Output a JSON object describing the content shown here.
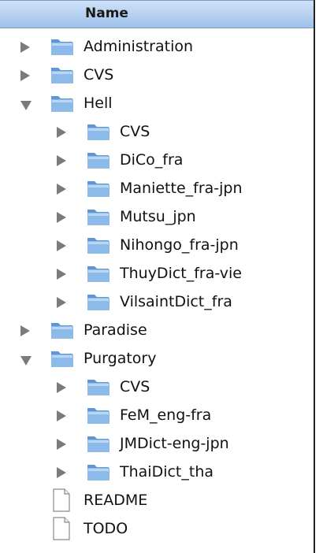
{
  "header": {
    "column_name": "Name"
  },
  "rows": [
    {
      "label": "Administration",
      "level": 0,
      "type": "folder",
      "state": "collapsed"
    },
    {
      "label": "CVS",
      "level": 0,
      "type": "folder",
      "state": "collapsed"
    },
    {
      "label": "Hell",
      "level": 0,
      "type": "folder",
      "state": "expanded"
    },
    {
      "label": "CVS",
      "level": 1,
      "type": "folder",
      "state": "collapsed"
    },
    {
      "label": "DiCo_fra",
      "level": 1,
      "type": "folder",
      "state": "collapsed"
    },
    {
      "label": "Maniette_fra-jpn",
      "level": 1,
      "type": "folder",
      "state": "collapsed"
    },
    {
      "label": "Mutsu_jpn",
      "level": 1,
      "type": "folder",
      "state": "collapsed"
    },
    {
      "label": "Nihongo_fra-jpn",
      "level": 1,
      "type": "folder",
      "state": "collapsed"
    },
    {
      "label": "ThuyDict_fra-vie",
      "level": 1,
      "type": "folder",
      "state": "collapsed"
    },
    {
      "label": "VilsaintDict_fra",
      "level": 1,
      "type": "folder",
      "state": "collapsed"
    },
    {
      "label": "Paradise",
      "level": 0,
      "type": "folder",
      "state": "collapsed"
    },
    {
      "label": "Purgatory",
      "level": 0,
      "type": "folder",
      "state": "expanded"
    },
    {
      "label": "CVS",
      "level": 1,
      "type": "folder",
      "state": "collapsed"
    },
    {
      "label": "FeM_eng-fra",
      "level": 1,
      "type": "folder",
      "state": "collapsed"
    },
    {
      "label": "JMDict-eng-jpn",
      "level": 1,
      "type": "folder",
      "state": "collapsed"
    },
    {
      "label": "ThaiDict_tha",
      "level": 1,
      "type": "folder",
      "state": "collapsed"
    },
    {
      "label": "README",
      "level": 0,
      "type": "file",
      "state": "none"
    },
    {
      "label": "TODO",
      "level": 0,
      "type": "file",
      "state": "none"
    }
  ],
  "icons": {
    "folder": "folder-icon",
    "file": "document-icon",
    "collapsed": "disclosure-triangle-right-icon",
    "expanded": "disclosure-triangle-down-icon"
  },
  "colors": {
    "header_gradient_top": "#cfe2f7",
    "header_gradient_bottom": "#9fc1ea",
    "folder_blue": "#7fb0e3",
    "triangle_gray": "#7b7b7b"
  }
}
